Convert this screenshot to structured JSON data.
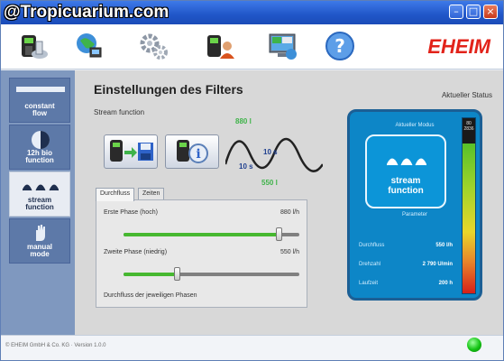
{
  "watermark": "@Tropicuarium.com",
  "window": {
    "buttons": [
      "–",
      "□",
      "×"
    ]
  },
  "toolbar": {
    "icons": [
      "filter-device-icon",
      "globe-network-icon",
      "gears-settings-icon",
      "device-user-icon",
      "computer-calendar-icon",
      "help-question-icon"
    ],
    "logo": "EHEIM"
  },
  "sidebar": {
    "items": [
      {
        "label_line1": "constant",
        "label_line2": "flow"
      },
      {
        "label_line1": "12h bio",
        "label_line2": "function"
      },
      {
        "label_line1": "stream",
        "label_line2": "function"
      },
      {
        "label_line1": "manual",
        "label_line2": "mode"
      }
    ]
  },
  "main": {
    "title": "Einstellungen des Filters",
    "subtitle": "Stream function",
    "status_heading": "Aktueller Status",
    "wave": {
      "top_value": "880 l",
      "bottom_value": "550 l",
      "left_time": "10 s",
      "right_time": "10 s"
    },
    "tabs": [
      "Durchfluss",
      "Zeiten"
    ],
    "sliders": [
      {
        "label": "Erste Phase (hoch)",
        "value_text": "880 l/h",
        "fraction": 0.88
      },
      {
        "label": "Zweite Phase (niedrig)",
        "value_text": "550 l/h",
        "fraction": 0.3
      }
    ],
    "footer_note": "Durchfluss der jeweiligen Phasen"
  },
  "status_panel": {
    "title": "Aktueller Modus",
    "mode_line1": "stream",
    "mode_line2": "function",
    "small_label": "Parameter",
    "rows": [
      {
        "label": "Durchfluss",
        "value": "550 l/h"
      },
      {
        "label": "Drehzahl",
        "value": "2 790 U/min"
      },
      {
        "label": "Laufzeit",
        "value": "200 h"
      }
    ],
    "gauge_top": "80 2836"
  },
  "statusbar": {
    "copyright": "© EHEIM GmbH & Co. KG · Version 1.0.0"
  },
  "colors": {
    "accent": "#0d86c7",
    "logo": "#e2231a",
    "slider_fill": "#46b830",
    "led": "#13c413"
  }
}
